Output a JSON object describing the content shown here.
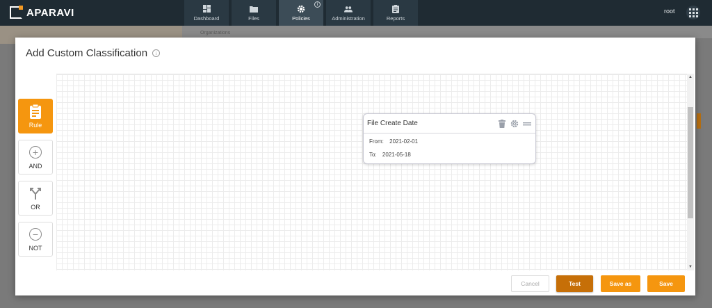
{
  "topbar": {
    "logo_text": "APARAVI",
    "nav": [
      {
        "label": "Dashboard",
        "icon": "dashboard-icon"
      },
      {
        "label": "Files",
        "icon": "folder-icon"
      },
      {
        "label": "Policies",
        "icon": "gear-icon",
        "active": true
      },
      {
        "label": "Administration",
        "icon": "users-icon"
      },
      {
        "label": "Reports",
        "icon": "clipboard-icon"
      }
    ],
    "user": "root"
  },
  "background": {
    "breadcrumb": "Organizations"
  },
  "modal": {
    "title": "Add Custom Classification",
    "tools": [
      {
        "label": "Rule",
        "icon": "clipboard-icon",
        "active": true
      },
      {
        "label": "AND",
        "icon": "plus-circle-icon"
      },
      {
        "label": "OR",
        "icon": "fork-arrow-icon"
      },
      {
        "label": "NOT",
        "icon": "minus-circle-icon"
      }
    ],
    "card": {
      "title": "File Create Date",
      "from_label": "From:",
      "from_value": "2021-02-01",
      "to_label": "To:",
      "to_value": "2021-05-18"
    },
    "buttons": {
      "cancel": "Cancel",
      "test": "Test",
      "save_as": "Save as",
      "save": "Save"
    }
  },
  "colors": {
    "accent": "#f5960f",
    "accent_dark": "#c66f08",
    "topbar": "#1f2b33"
  }
}
